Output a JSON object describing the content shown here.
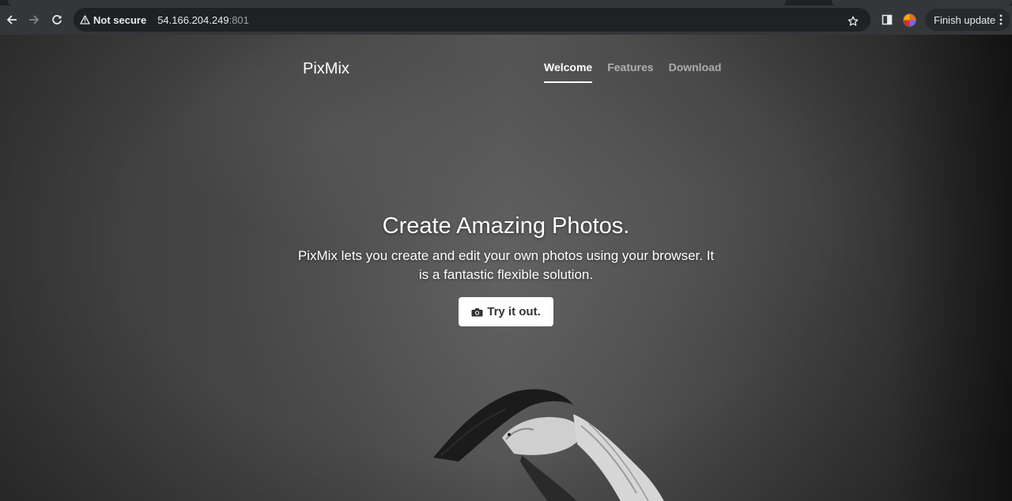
{
  "browser": {
    "security_label": "Not secure",
    "url_host": "54.166.204.249",
    "url_port": ":801",
    "finish_update_label": "Finish update",
    "icons": [
      "back-icon",
      "forward-icon",
      "reload-icon",
      "warning-icon",
      "star-icon",
      "side-panel-icon",
      "kebab-menu-icon"
    ]
  },
  "site": {
    "brand": "PixMix",
    "nav": [
      {
        "label": "Welcome",
        "active": true
      },
      {
        "label": "Features",
        "active": false
      },
      {
        "label": "Download",
        "active": false
      }
    ],
    "hero": {
      "title": "Create Amazing Photos.",
      "lead": "PixMix lets you create and edit your own photos using your browser. It is a fantastic flexible solution.",
      "button_label": "Try it out.",
      "button_icon": "camera-icon"
    }
  },
  "colors": {
    "chrome_toolbar": "#35363a",
    "omnibox": "#202124",
    "page_text": "#ffffff",
    "button_bg": "#ffffff",
    "button_text": "#333333"
  }
}
